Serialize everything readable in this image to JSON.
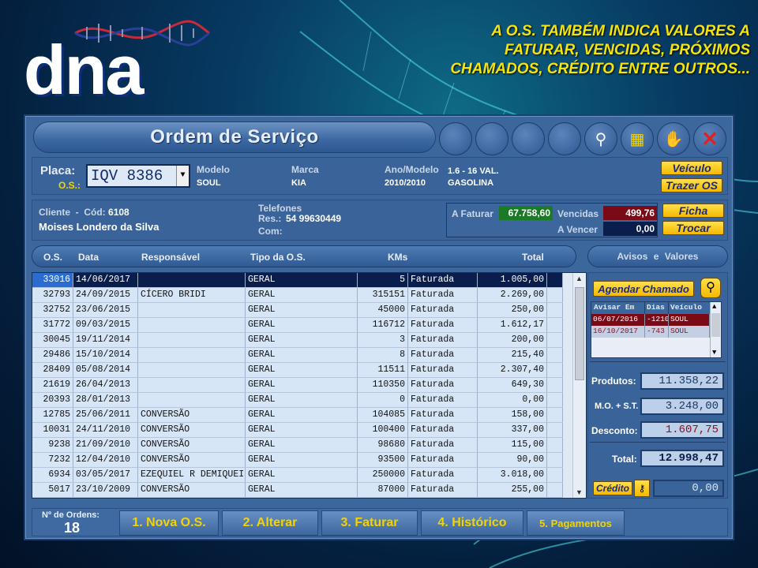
{
  "promo_text": "A O.S. TAMBÉM INDICA VALORES A FATURAR, VENCIDAS, PRÓXIMOS CHAMADOS, CRÉDITO ENTRE OUTROS...",
  "logo_text": "dna",
  "window_title": "Ordem de Serviço",
  "vehicle": {
    "placa_label": "Placa:",
    "os_label": "O.S.:",
    "placa_value": "IQV 8386",
    "modelo_label": "Modelo",
    "modelo_value": "SOUL",
    "marca_label": "Marca",
    "marca_value": "KIA",
    "ano_label": "Ano/Modelo",
    "ano_value": "2010/2010",
    "motor_value": "1.6 - 16 VAL.",
    "combustivel_value": "GASOLINA"
  },
  "buttons": {
    "veiculo": "Veículo",
    "trazer_os": "Trazer OS",
    "ficha": "Ficha",
    "trocar": "Trocar",
    "agendar": "Agendar Chamado",
    "credito": "Crédito"
  },
  "client": {
    "cliente_label": "Cliente",
    "cod_label": "Cód:",
    "cod_value": "6108",
    "name": "Moises Londero da Silva",
    "telefones_label": "Telefones",
    "res_label": "Res.:",
    "res_value": "54 99630449",
    "com_label": "Com:"
  },
  "finance": {
    "a_faturar_label": "A Faturar",
    "a_faturar_value": "67.758,60",
    "vencidas_label": "Vencidas",
    "vencidas_value": "499,76",
    "a_vencer_label": "A Vencer",
    "a_vencer_value": "0,00"
  },
  "table": {
    "headers": [
      "O.S.",
      "Data",
      "Responsável",
      "Tipo da O.S.",
      "KMs",
      "Total"
    ],
    "rows": [
      [
        "33016",
        "14/06/2017",
        "",
        "GERAL",
        "5",
        "Faturada",
        "1.005,00"
      ],
      [
        "32793",
        "24/09/2015",
        "CÍCERO BRIDI",
        "GERAL",
        "315151",
        "Faturada",
        "2.269,00"
      ],
      [
        "32752",
        "23/06/2015",
        "",
        "GERAL",
        "45000",
        "Faturada",
        "250,00"
      ],
      [
        "31772",
        "09/03/2015",
        "",
        "GERAL",
        "116712",
        "Faturada",
        "1.612,17"
      ],
      [
        "30045",
        "19/11/2014",
        "",
        "GERAL",
        "3",
        "Faturada",
        "200,00"
      ],
      [
        "29486",
        "15/10/2014",
        "",
        "GERAL",
        "8",
        "Faturada",
        "215,40"
      ],
      [
        "28409",
        "05/08/2014",
        "",
        "GERAL",
        "11511",
        "Faturada",
        "2.307,40"
      ],
      [
        "21619",
        "26/04/2013",
        "",
        "GERAL",
        "110350",
        "Faturada",
        "649,30"
      ],
      [
        "20393",
        "28/01/2013",
        "",
        "GERAL",
        "0",
        "Faturada",
        "0,00"
      ],
      [
        "12785",
        "25/06/2011",
        "CONVERSÃO",
        "GERAL",
        "104085",
        "Faturada",
        "158,00"
      ],
      [
        "10031",
        "24/11/2010",
        "CONVERSÃO",
        "GERAL",
        "100400",
        "Faturada",
        "337,00"
      ],
      [
        "9238",
        "21/09/2010",
        "CONVERSÃO",
        "GERAL",
        "98680",
        "Faturada",
        "115,00"
      ],
      [
        "7232",
        "12/04/2010",
        "CONVERSÃO",
        "GERAL",
        "93500",
        "Faturada",
        "90,00"
      ],
      [
        "6934",
        "03/05/2017",
        "EZEQUIEL R DEMIQUEI",
        "GERAL",
        "250000",
        "Faturada",
        "3.018,00"
      ],
      [
        "5017",
        "23/10/2009",
        "CONVERSÃO",
        "GERAL",
        "87000",
        "Faturada",
        "255,00"
      ]
    ]
  },
  "avisos": {
    "title": "Avisos   e   Valores",
    "headers": [
      "Avisar Em",
      "Dias",
      "Veículo"
    ],
    "rows": [
      [
        "06/07/2016",
        "-1210",
        "SOUL"
      ],
      [
        "16/10/2017",
        "-743",
        "SOUL"
      ]
    ]
  },
  "totals": {
    "produtos_label": "Produtos:",
    "produtos_value": "11.358,22",
    "mo_label": "M.O. + S.T.",
    "mo_value": "3.248,00",
    "desconto_label": "Desconto:",
    "desconto_value": "1.607,75",
    "total_label": "Total:",
    "total_value": "12.998,47",
    "credito_value": "0,00"
  },
  "footer": {
    "ordens_label": "Nº de Ordens:",
    "ordens_value": "18",
    "b1": "1. Nova O.S.",
    "b2": "2. Alterar",
    "b3": "3. Faturar",
    "b4": "4. Histórico",
    "b5": "5. Pagamentos"
  }
}
